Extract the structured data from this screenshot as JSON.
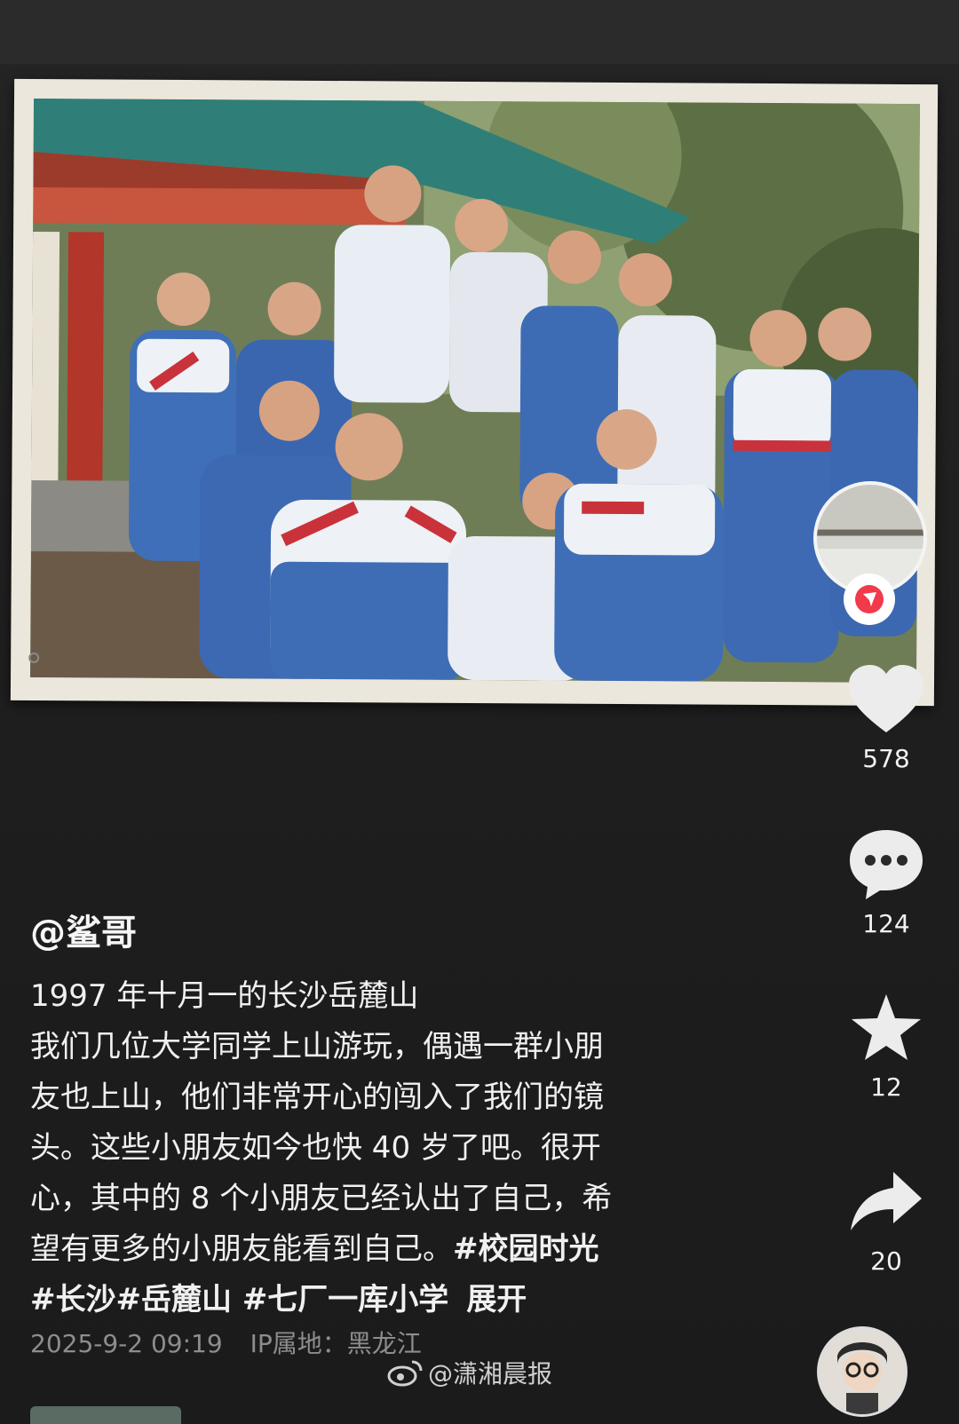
{
  "post": {
    "author": "@鲨哥",
    "caption_lines": [
      "1997 年十月一的长沙岳麓山",
      "我们几位大学同学上山游玩，偶遇一群小朋",
      "友也上山，他们非常开心的闯入了我们的镜",
      "头。这些小朋友如今也快 40 岁了吧。很开",
      "心，其中的 8 个小朋友已经认出了自己，希",
      "望有更多的小朋友能看到自己。"
    ],
    "hashtags_inline": "#校园时光",
    "hashtags": "#长沙#岳麓山 #七厂一库小学",
    "expand_label": "展开",
    "date": "2025-9-2 09:19",
    "ip_location": "IP属地：黑龙江"
  },
  "actions": {
    "likes": "578",
    "comments": "124",
    "favorites": "12",
    "shares": "20"
  },
  "watermark": {
    "text": "@潇湘晨报",
    "icon": "weibo-icon"
  },
  "colors": {
    "background": "#1f1f1f",
    "text": "#f0f0f0",
    "meta": "#8d8d8d",
    "badge_red": "#f23a4a"
  }
}
